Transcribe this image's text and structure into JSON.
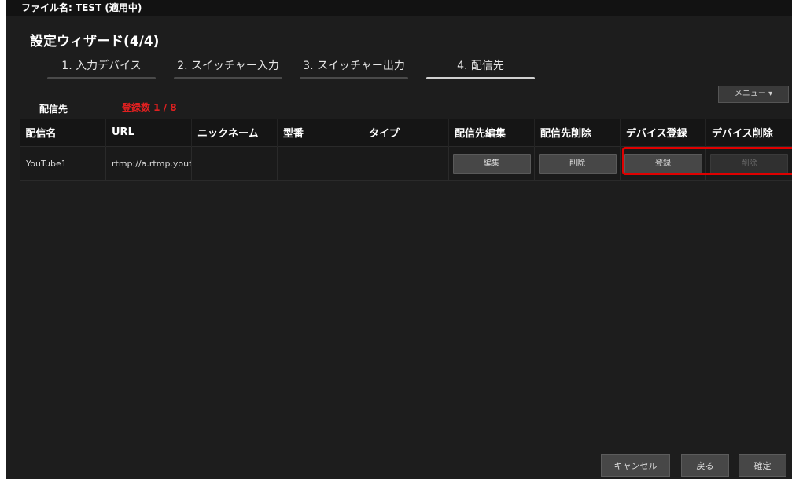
{
  "header": {
    "file_label": "ファイル名: TEST (適用中)"
  },
  "wizard": {
    "title": "設定ウィザード(4/4)",
    "steps": [
      {
        "label": "1. 入力デバイス",
        "active": false
      },
      {
        "label": "2. スイッチャー入力",
        "active": false
      },
      {
        "label": "3. スイッチャー出力",
        "active": false
      },
      {
        "label": "4. 配信先",
        "active": true
      }
    ]
  },
  "menu": {
    "label": "メニュー ▾"
  },
  "section": {
    "label": "配信先",
    "count_text": "登録数 1 / 8"
  },
  "table": {
    "headers": [
      "配信名",
      "URL",
      "ニックネーム",
      "型番",
      "タイプ",
      "配信先編集",
      "配信先削除",
      "デバイス登録",
      "デバイス削除"
    ],
    "rows": [
      {
        "name": "YouTube1",
        "url": "rtmp://a.rtmp.youtube.",
        "nickname": "",
        "model": "",
        "type": "",
        "edit_label": "編集",
        "delete_label": "削除",
        "register_label": "登録",
        "device_delete_label": "削除"
      }
    ]
  },
  "footer": {
    "cancel": "キャンセル",
    "back": "戻る",
    "confirm": "確定"
  },
  "colors": {
    "highlight": "#e00000",
    "count": "#e02020",
    "background": "#1d1d1d"
  }
}
